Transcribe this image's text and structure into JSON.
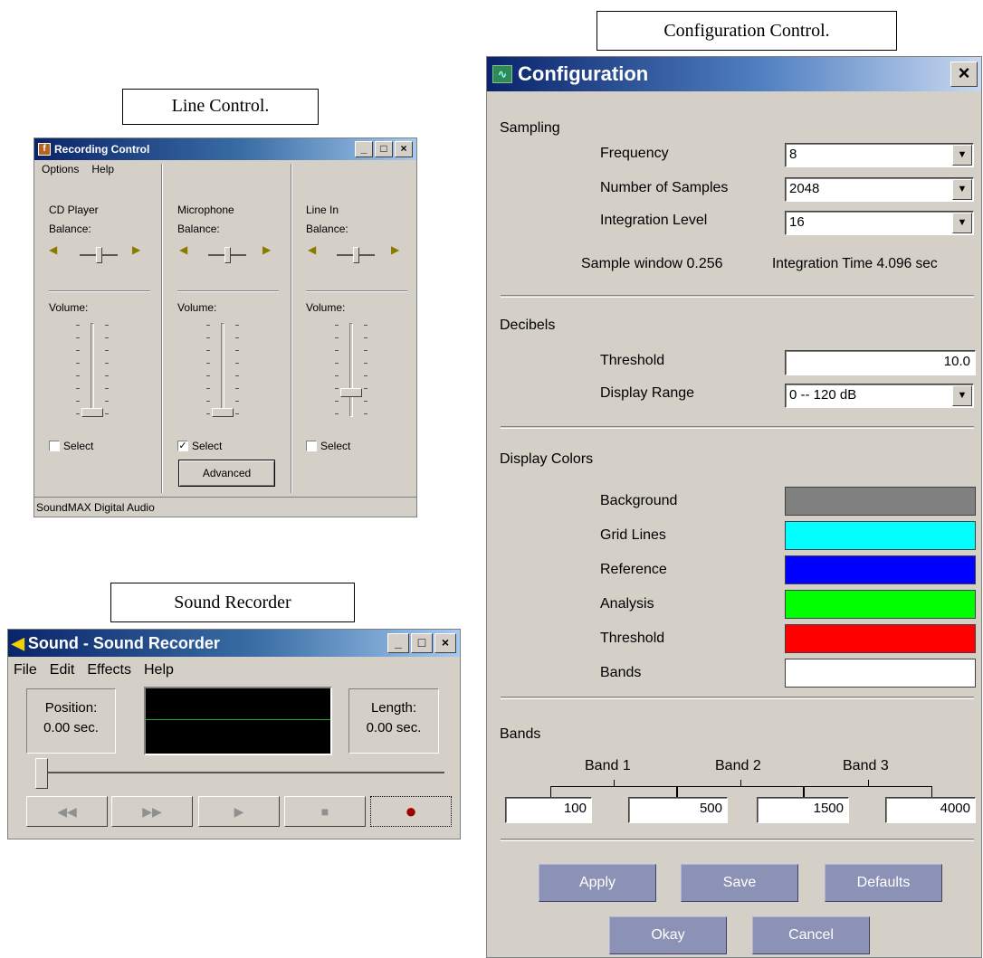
{
  "captions": {
    "configuration": "Configuration Control.",
    "line": "Line Control.",
    "sound": "Sound Recorder"
  },
  "recording_control": {
    "title": "Recording Control",
    "menu": [
      "Options",
      "Help"
    ],
    "channels": [
      {
        "name": "CD Player",
        "balance": "Balance:",
        "volume": "Volume:",
        "select": "Select",
        "selected": false,
        "volume_level": 0.0
      },
      {
        "name": "Microphone",
        "balance": "Balance:",
        "volume": "Volume:",
        "select": "Select",
        "selected": true,
        "volume_level": 0.0
      },
      {
        "name": "Line In",
        "balance": "Balance:",
        "volume": "Volume:",
        "select": "Select",
        "selected": false,
        "volume_level": 0.25
      }
    ],
    "advanced_label": "Advanced",
    "status": "SoundMAX Digital Audio"
  },
  "sound_recorder": {
    "title": "Sound - Sound Recorder",
    "menu": [
      "File",
      "Edit",
      "Effects",
      "Help"
    ],
    "position_label": "Position:",
    "position_value": "0.00 sec.",
    "length_label": "Length:",
    "length_value": "0.00 sec.",
    "buttons": {
      "rewind": "◀◀",
      "forward": "▶▶",
      "play": "▶",
      "stop": "■",
      "record": "●"
    },
    "record_color": "#a00000"
  },
  "configuration": {
    "title": "Configuration",
    "close": "×",
    "sampling": {
      "heading": "Sampling",
      "frequency_label": "Frequency",
      "frequency_value": "8",
      "samples_label": "Number of Samples",
      "samples_value": "2048",
      "integration_label": "Integration Level",
      "integration_value": "16",
      "sample_window": "Sample window 0.256",
      "integration_time": "Integration Time 4.096 sec"
    },
    "decibels": {
      "heading": "Decibels",
      "threshold_label": "Threshold",
      "threshold_value": "10.0",
      "range_label": "Display Range",
      "range_value": "0 -- 120 dB"
    },
    "display_colors": {
      "heading": "Display Colors",
      "items": [
        {
          "label": "Background",
          "color": "#808080"
        },
        {
          "label": "Grid Lines",
          "color": "#00ffff"
        },
        {
          "label": "Reference",
          "color": "#0000ff"
        },
        {
          "label": "Analysis",
          "color": "#00ff00"
        },
        {
          "label": "Threshold",
          "color": "#ff0000"
        },
        {
          "label": "Bands",
          "color": "#ffffff"
        }
      ]
    },
    "bands": {
      "heading": "Bands",
      "labels": [
        "Band 1",
        "Band 2",
        "Band 3"
      ],
      "values": [
        "100",
        "500",
        "1500",
        "4000"
      ]
    },
    "buttons": {
      "apply": "Apply",
      "save": "Save",
      "defaults": "Defaults",
      "okay": "Okay",
      "cancel": "Cancel"
    },
    "button_color": "#8c91b6"
  }
}
